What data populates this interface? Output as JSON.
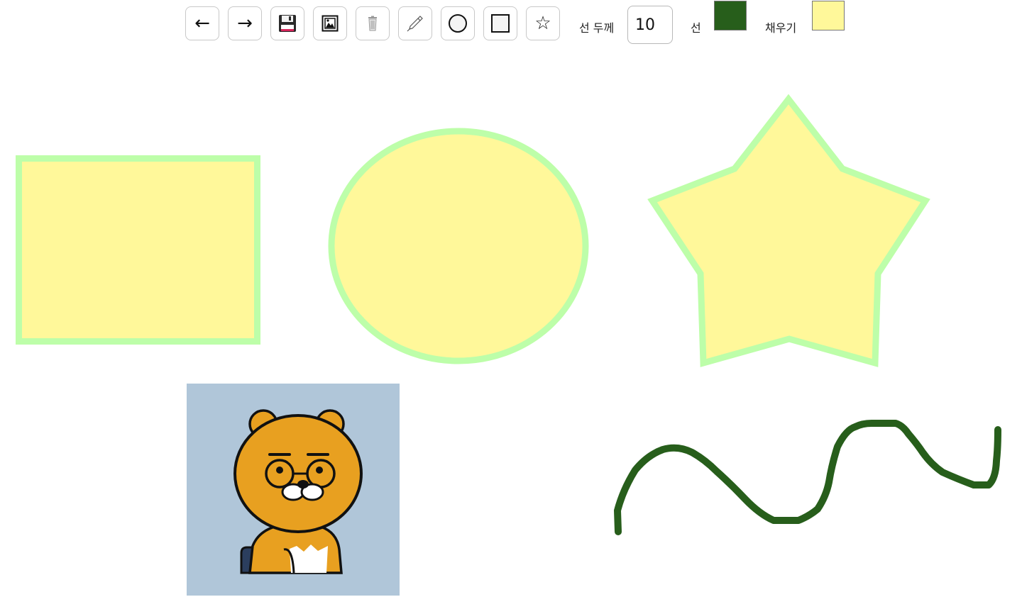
{
  "toolbar": {
    "undo_label": "←",
    "redo_label": "→",
    "save_icon": "floppy-disk-icon",
    "image_icon": "picture-frame-icon",
    "trash_icon": "trash-can-icon",
    "pen_icon": "pen-icon",
    "circle_icon": "circle-icon",
    "rect_icon": "square-icon",
    "star_label": "☆",
    "line_width_label": "선 두께",
    "line_width_value": "10",
    "stroke_label": "선",
    "stroke_color": "#275e1b",
    "fill_label": "채우기",
    "fill_color": "#fff89a"
  },
  "canvas": {
    "shape_stroke_color": "#bdfea9",
    "shape_fill_color": "#fff89a",
    "freehand_color": "#275e1b",
    "shapes": [
      "rectangle",
      "ellipse",
      "star",
      "image",
      "freehand-line"
    ],
    "image": {
      "name": "bear-character-image",
      "background": "#b0c6d9"
    }
  }
}
